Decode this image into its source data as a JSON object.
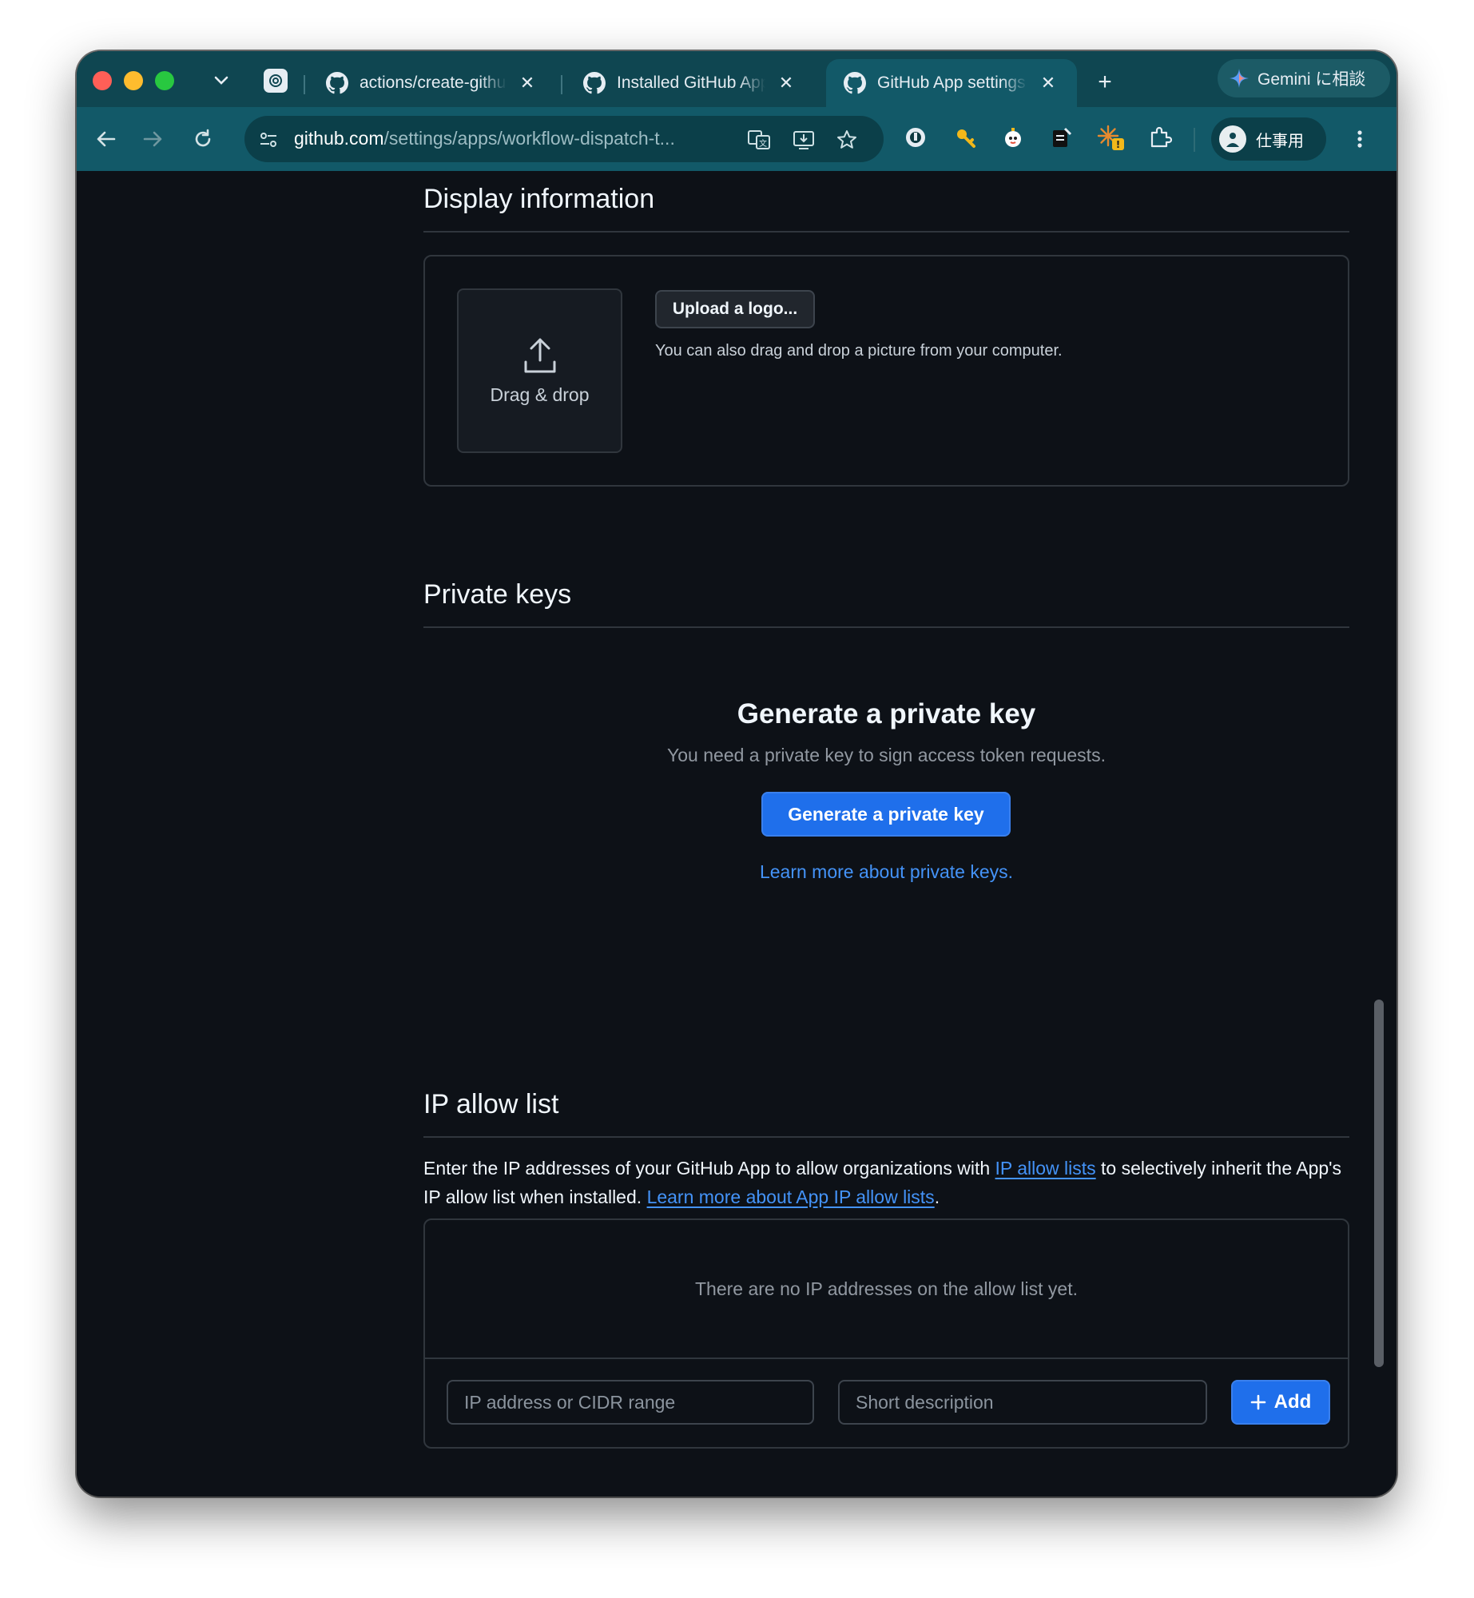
{
  "browser": {
    "tabs": [
      {
        "title": "actions/create-github",
        "icon": "github-icon",
        "active": false
      },
      {
        "title": "Installed GitHub Apps",
        "icon": "github-icon",
        "active": false
      },
      {
        "title": "GitHub App settings",
        "icon": "github-icon",
        "active": true
      }
    ],
    "gemini_label": "Gemini に相談",
    "url_domain": "github.com",
    "url_path": "/settings/apps/workflow-dispatch-t...",
    "profile_label": "仕事用",
    "colors": {
      "tabbar": "#0f4651",
      "toolbar": "#125968",
      "page_bg": "#0d1117",
      "accent": "#1f6feb"
    }
  },
  "display_information": {
    "heading": "Display information",
    "drop_label": "Drag & drop",
    "upload_button": "Upload a logo...",
    "upload_hint": "You can also drag and drop a picture from your computer."
  },
  "private_keys": {
    "heading": "Private keys",
    "blank_title": "Generate a private key",
    "blank_text": "You need a private key to sign access token requests.",
    "generate_button": "Generate a private key",
    "learn_more": "Learn more about private keys."
  },
  "ip_allow_list": {
    "heading": "IP allow list",
    "desc_part1": "Enter the IP addresses of your GitHub App to allow organizations with",
    "desc_link1": "IP allow lists",
    "desc_part2": "to selectively inherit the App's IP allow list when installed.",
    "desc_link2": "Learn more about App IP allow lists",
    "desc_end": ".",
    "empty_text": "There are no IP addresses on the allow list yet.",
    "ip_placeholder": "IP address or CIDR range",
    "desc_placeholder": "Short description",
    "add_button": "Add"
  }
}
